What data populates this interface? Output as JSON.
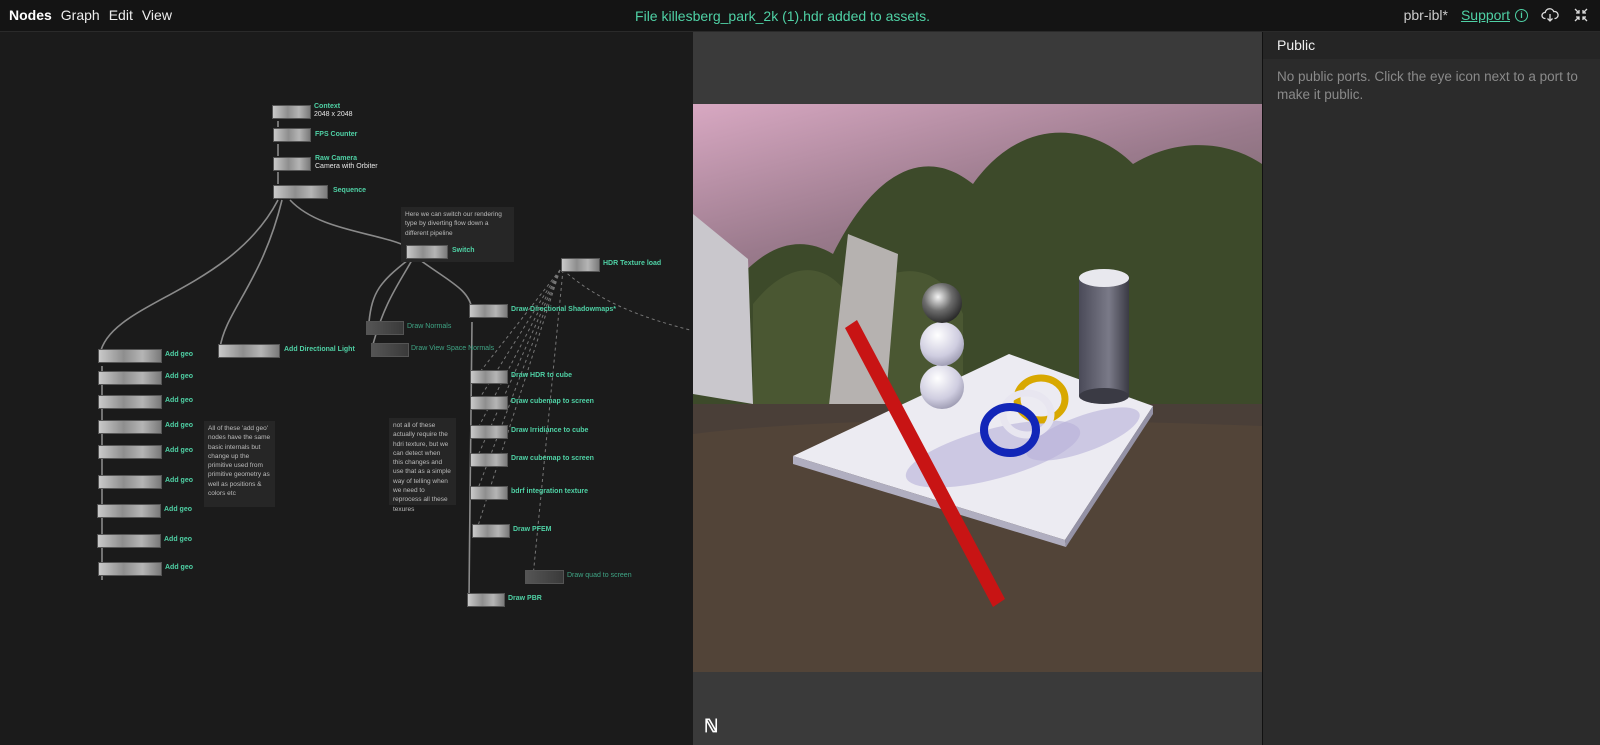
{
  "menu": {
    "brand": "Nodes",
    "items": [
      "Graph",
      "Edit",
      "View"
    ]
  },
  "notice": "File killesberg_park_2k (1).hdr added to assets.",
  "project": {
    "name": "pbr-ibl*",
    "support": "Support"
  },
  "colors": {
    "accent": "#4fd1a5",
    "panel": "#2b2b2b",
    "graph_bg": "#1b1b1b"
  },
  "nodes": {
    "context": "Context",
    "context_sub": "2048 x 2048",
    "fps": "FPS Counter",
    "camera": "Raw Camera",
    "camera_sub": "Camera with Orbiter",
    "sequence": "Sequence",
    "switch": "Switch",
    "hdr": "HDR Texture load",
    "shadow": "Draw Directional Shadowmaps*",
    "normals": "Draw  Normals",
    "vsnormals": "Draw View Space Normals",
    "hdrcube": "Draw HDR to cube",
    "cube1": "Draw cubemap to screen",
    "irr": "Draw Irridiance to cube",
    "cube2": "Draw cubemap to screen",
    "brdf": "bdrf integration texture",
    "pfem": "Draw PFEM",
    "quad": "Draw quad to screen",
    "pbr": "Draw  PBR",
    "dirlight": "Add Directional Light",
    "addgeo": "Add geo"
  },
  "comments": {
    "switch_note": "Here we can switch our rendering type by diverting flow down a different pipeline",
    "geo_note": "All of these 'add geo' nodes have the same basic internals but change up the primitive used from primitive geometry as well as positions & colors etc",
    "hdr_note": "not all of these actually require  the hdri texture, but we can detect when this changes and use that as a simple way of telling when we need to reprocess all these texures"
  },
  "viewport": {
    "logo": "ℕ"
  },
  "panel": {
    "title": "Public",
    "empty_message": "No public ports. Click the eye icon next to a port to make it public."
  },
  "icons": {
    "info": "info-icon",
    "cloud": "cloud-download-icon",
    "close": "collapse-icon"
  }
}
